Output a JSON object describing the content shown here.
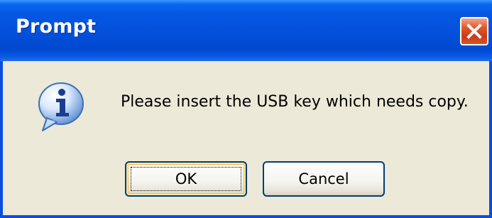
{
  "window": {
    "title": "Prompt",
    "close_icon": "close-icon"
  },
  "dialog": {
    "icon": "info-icon",
    "message": "Please insert the USB key which needs copy."
  },
  "buttons": {
    "ok_label": "OK",
    "cancel_label": "Cancel"
  },
  "colors": {
    "titlebar": "#0351dc",
    "body": "#ece9d8",
    "close_button": "#e25a2c"
  }
}
